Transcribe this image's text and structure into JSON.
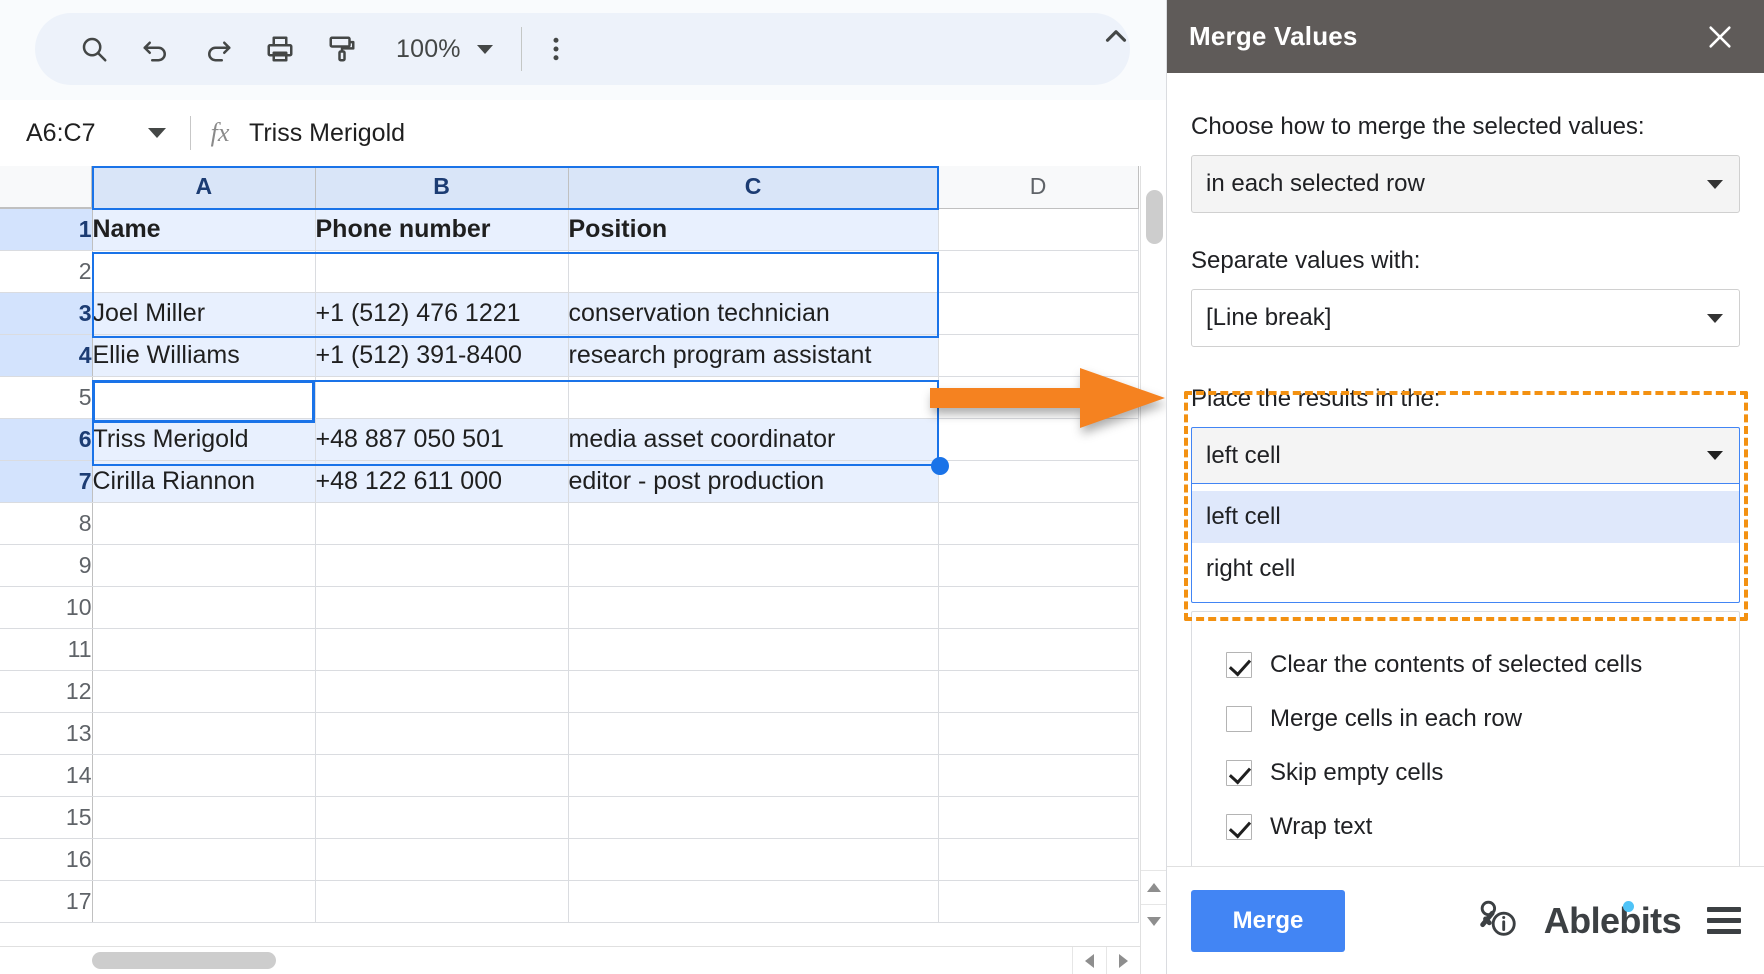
{
  "toolbar": {
    "icons": [
      "search-icon",
      "undo-icon",
      "redo-icon",
      "print-icon",
      "paint-format-icon"
    ],
    "zoom_value": "100%",
    "more_label": "⋮",
    "collapse_label": "^"
  },
  "formula_bar": {
    "name_box_value": "A6:C7",
    "fx_label": "fx",
    "formula_value": "Triss Merigold"
  },
  "grid": {
    "columns": [
      "A",
      "B",
      "C",
      "D"
    ],
    "selected_columns": [
      "A",
      "B",
      "C"
    ],
    "rows": [
      {
        "num": "1",
        "selected": true,
        "bold": true,
        "cells": [
          "Name",
          "Phone number",
          "Position"
        ]
      },
      {
        "num": "2",
        "selected": false,
        "bold": false,
        "cells": [
          "",
          "",
          ""
        ]
      },
      {
        "num": "3",
        "selected": true,
        "bold": false,
        "cells": [
          "Joel Miller",
          "+1 (512) 476 1221",
          "conservation technician"
        ]
      },
      {
        "num": "4",
        "selected": true,
        "bold": false,
        "cells": [
          "Ellie Williams",
          "+1 (512) 391-8400",
          "research program assistant"
        ]
      },
      {
        "num": "5",
        "selected": false,
        "bold": false,
        "cells": [
          "",
          "",
          ""
        ]
      },
      {
        "num": "6",
        "selected": true,
        "bold": false,
        "cells": [
          "Triss Merigold",
          "+48 887 050 501",
          "media asset coordinator"
        ]
      },
      {
        "num": "7",
        "selected": true,
        "bold": false,
        "cells": [
          "Cirilla Riannon",
          "+48 122 611 000",
          "editor - post production"
        ]
      },
      {
        "num": "8",
        "selected": false,
        "bold": false,
        "cells": [
          "",
          "",
          ""
        ]
      },
      {
        "num": "9",
        "selected": false,
        "bold": false,
        "cells": [
          "",
          "",
          ""
        ]
      },
      {
        "num": "10",
        "selected": false,
        "bold": false,
        "cells": [
          "",
          "",
          ""
        ]
      },
      {
        "num": "11",
        "selected": false,
        "bold": false,
        "cells": [
          "",
          "",
          ""
        ]
      },
      {
        "num": "12",
        "selected": false,
        "bold": false,
        "cells": [
          "",
          "",
          ""
        ]
      },
      {
        "num": "13",
        "selected": false,
        "bold": false,
        "cells": [
          "",
          "",
          ""
        ]
      },
      {
        "num": "14",
        "selected": false,
        "bold": false,
        "cells": [
          "",
          "",
          ""
        ]
      },
      {
        "num": "15",
        "selected": false,
        "bold": false,
        "cells": [
          "",
          "",
          ""
        ]
      },
      {
        "num": "16",
        "selected": false,
        "bold": false,
        "cells": [
          "",
          "",
          ""
        ]
      },
      {
        "num": "17",
        "selected": false,
        "bold": false,
        "cells": [
          "",
          "",
          ""
        ]
      }
    ],
    "active_cell": "A6",
    "selection_color": "#1a73e8",
    "selected_fill": "#e8f0fe"
  },
  "annotation": {
    "arrow_color": "#f58220",
    "highlight_color": "#f39111"
  },
  "sidebar": {
    "title": "Merge Values",
    "close_label": "×",
    "merge_how_label": "Choose how to merge the selected values:",
    "merge_how_value": "in each selected row",
    "separator_label": "Separate values with:",
    "separator_value": "[Line break]",
    "place_label": "Place the results in the:",
    "place_value": "left cell",
    "place_options": [
      {
        "label": "left cell",
        "highlighted": true
      },
      {
        "label": "right cell",
        "highlighted": false
      }
    ],
    "checkboxes": [
      {
        "label": "Clear the contents of selected cells",
        "checked": true
      },
      {
        "label": "Merge cells in each row",
        "checked": false
      },
      {
        "label": "Skip empty cells",
        "checked": true
      },
      {
        "label": "Wrap text",
        "checked": true
      }
    ],
    "merge_button": "Merge",
    "brand": "Ablebits",
    "accent_color": "#4285f4",
    "header_color": "#5f5b59"
  }
}
